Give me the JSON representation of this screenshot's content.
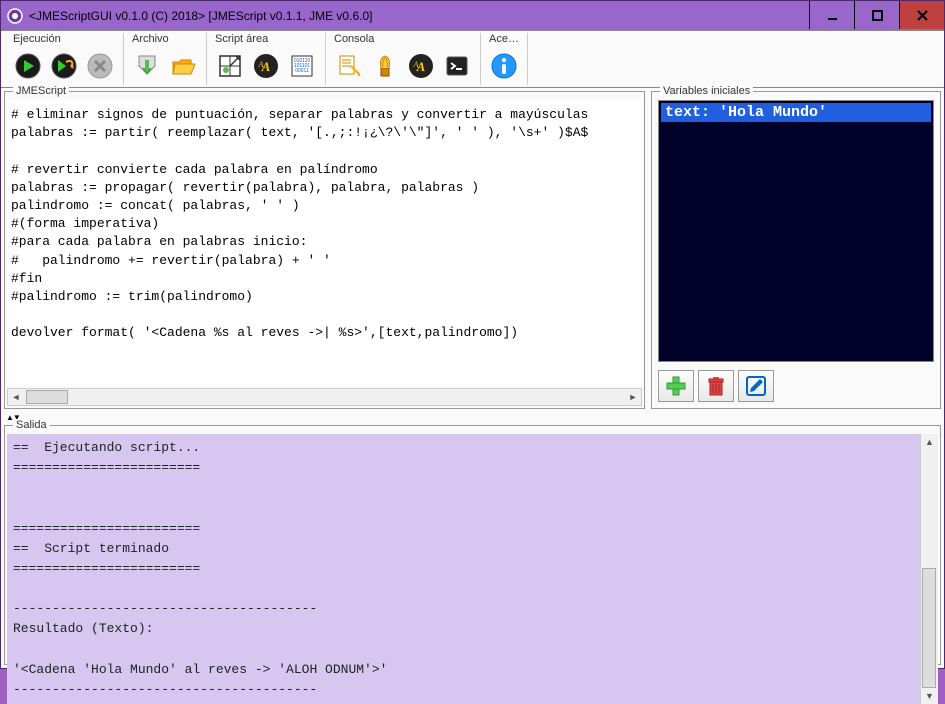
{
  "titlebar": {
    "title": "<JMEScriptGUI v0.1.0  (C) 2018>       [JMEScript v0.1.1, JME v0.6.0]"
  },
  "toolbar": {
    "groups": {
      "ejecucion": "Ejecución",
      "archivo": "Archivo",
      "script_area": "Script área",
      "consola": "Consola",
      "ace": "Ace…"
    }
  },
  "panels": {
    "script_title": "JMEScript",
    "vars_title": "Variables iniciales",
    "output_title": "Salida"
  },
  "script": {
    "content": "# eliminar signos de puntuación, separar palabras y convertir a mayúsculas\npalabras := partir( reemplazar( text, '[.,;:!¡¿\\?\\'\\\"]', ' ' ), '\\s+' )$A$\n\n# revertir convierte cada palabra en palíndromo\npalabras := propagar( revertir(palabra), palabra, palabras )\npalindromo := concat( palabras, ' ' )\n#(forma imperativa)\n#para cada palabra en palabras inicio:\n#   palindromo += revertir(palabra) + ' '\n#fin\n#palindromo := trim(palindromo)\n\ndevolver format( '<Cadena %s al reves ->| %s>',[text,palindromo])"
  },
  "variables": {
    "items": [
      "text:  'Hola Mundo'"
    ]
  },
  "output": {
    "content": "==  Ejecutando script...\n========================\n\n\n========================\n==  Script terminado\n========================\n\n---------------------------------------\nResultado (Texto):\n\n'<Cadena 'Hola Mundo' al reves -> 'ALOH ODNUM'>'\n---------------------------------------"
  }
}
